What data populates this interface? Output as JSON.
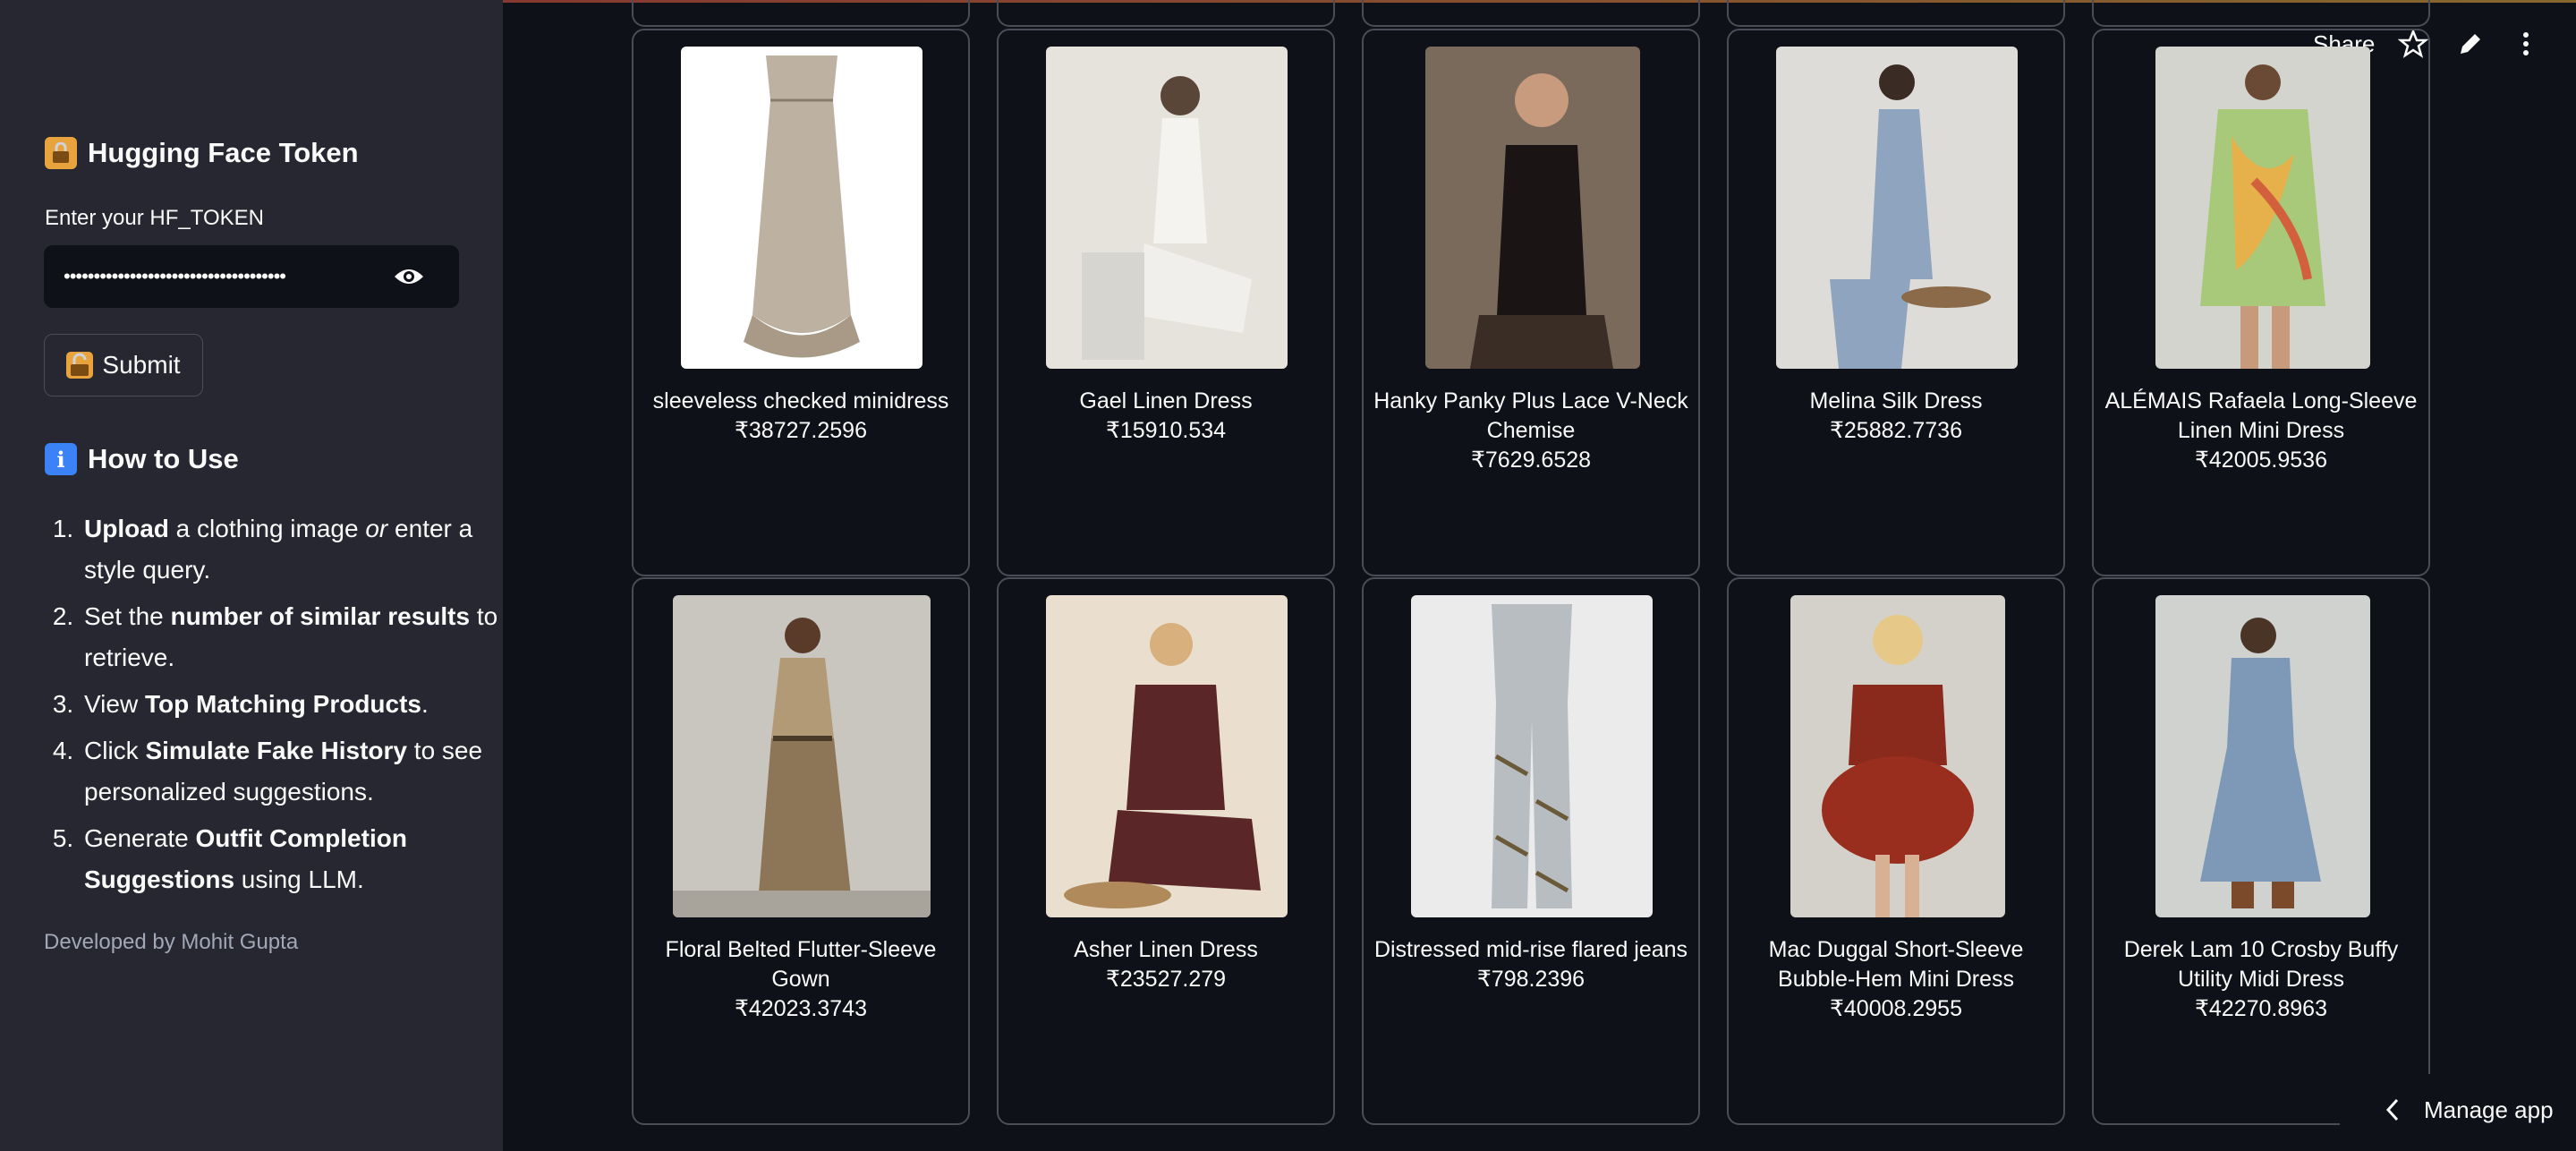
{
  "sidebar": {
    "token_heading": "Hugging Face Token",
    "token_label": "Enter your HF_TOKEN",
    "token_value": "•••••••••••••••••••••••••••••••••••••",
    "submit_label": "Submit",
    "howto_heading": "How to Use",
    "steps": [
      {
        "bold": "Upload",
        "rest": " a clothing image ",
        "em": "or",
        "tail": " enter a style query."
      },
      {
        "pre": "Set the ",
        "bold": "number of similar results",
        "tail": " to retrieve."
      },
      {
        "pre": "View ",
        "bold": "Top Matching Products",
        "tail": "."
      },
      {
        "pre": "Click ",
        "bold": "Simulate Fake History",
        "tail": " to see personalized suggestions."
      },
      {
        "pre": "Generate ",
        "bold": "Outfit Completion Suggestions",
        "tail": " using LLM."
      }
    ],
    "developer": "Developed by Mohit Gupta"
  },
  "header": {
    "share_label": "Share"
  },
  "products": [
    {
      "name": "sleeveless checked minidress",
      "price": "₹38727.2596"
    },
    {
      "name": "Gael Linen Dress",
      "price": "₹15910.534"
    },
    {
      "name": "Hanky Panky Plus Lace V-Neck Chemise",
      "price": "₹7629.6528"
    },
    {
      "name": "Melina Silk Dress",
      "price": "₹25882.7736"
    },
    {
      "name": "ALÉMAIS Rafaela Long-Sleeve Linen Mini Dress",
      "price": "₹42005.9536"
    },
    {
      "name": "Floral Belted Flutter-Sleeve Gown",
      "price": "₹42023.3743"
    },
    {
      "name": "Asher Linen Dress",
      "price": "₹23527.279"
    },
    {
      "name": "Distressed mid-rise flared jeans",
      "price": "₹798.2396"
    },
    {
      "name": "Mac Duggal Short-Sleeve Bubble-Hem Mini Dress",
      "price": "₹40008.2955"
    },
    {
      "name": "Derek Lam 10 Crosby Buffy Utility Midi Dress",
      "price": "₹42270.8963"
    }
  ],
  "footer": {
    "manage_label": "Manage app"
  },
  "colors": {
    "bg": "#0e1117",
    "sidebar": "#262730",
    "border": "#4a4d57",
    "text": "#fafafa",
    "muted": "#a3a8b8"
  },
  "icons": [
    "lock-icon",
    "info-icon",
    "eye-icon",
    "unlock-icon",
    "star-icon",
    "pencil-icon",
    "more-vertical-icon",
    "chevron-left-icon"
  ]
}
